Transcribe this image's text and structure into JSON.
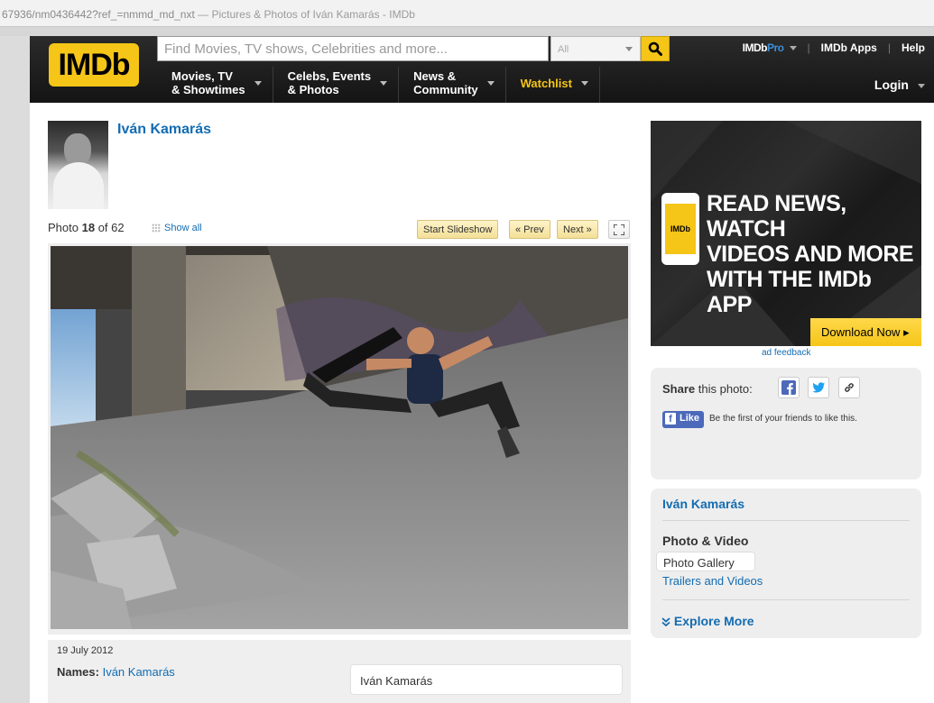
{
  "browser": {
    "url": "67936/nm0436442?ref_=nmmd_md_nxt",
    "tab_title": " — Pictures & Photos of Iván Kamarás - IMDb"
  },
  "header": {
    "logo": "IMDb",
    "search_placeholder": "Find Movies, TV shows, Celebrities and more...",
    "search_category": "All",
    "pro_brand": "IMDb",
    "pro_suffix": "Pro",
    "apps": "IMDb Apps",
    "help": "Help",
    "nav": [
      {
        "line1": "Movies, TV",
        "line2": "& Showtimes"
      },
      {
        "line1": "Celebs, Events",
        "line2": "& Photos"
      },
      {
        "line1": "News &",
        "line2": "Community"
      }
    ],
    "watchlist": "Watchlist",
    "login": "Login",
    "accent": "#f5c518"
  },
  "main": {
    "name": "Iván Kamarás",
    "photo_label": "Photo",
    "photo_index": "18",
    "photo_of": "of",
    "photo_total": "62",
    "show_all": "Show all",
    "slideshow": "Start Slideshow",
    "prev": "« Prev",
    "next": "Next »",
    "date": "19 July 2012",
    "names_label": "Names:",
    "names_value": "Iván Kamarás",
    "name_box": "Iván Kamarás"
  },
  "ad": {
    "phone_logo": "IMDb",
    "headline_1": "READ NEWS, WATCH",
    "headline_2": "VIDEOS AND MORE",
    "headline_3": "WITH THE IMDb APP",
    "download": "Download Now",
    "feedback": "ad feedback"
  },
  "share": {
    "label_bold": "Share",
    "label_rest": "this photo:",
    "like": "Like",
    "like_text": "Be the first of your friends to like this."
  },
  "links": {
    "name": "Iván Kamarás",
    "heading": "Photo & Video",
    "gallery": "Photo Gallery",
    "trailers": "Trailers and Videos",
    "explore": "Explore More"
  },
  "colors": {
    "link": "#136cb2",
    "facebook": "#4c69ba",
    "twitter": "#1da1f2"
  }
}
